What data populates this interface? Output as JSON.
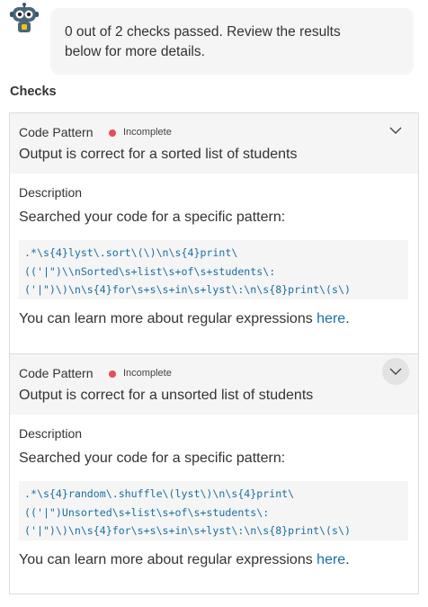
{
  "message": {
    "line1": "0 out of 2 checks passed. Review the results",
    "line2": "below for more details."
  },
  "section_title": "Checks",
  "checks": [
    {
      "type": "Code Pattern",
      "status": "Incomplete",
      "title": "Output is correct for a sorted list of students",
      "description_label": "Description",
      "description": "Searched your code for a specific pattern:",
      "pattern_lines": [
        ".*\\s{4}lyst\\.sort\\(\\)\\n\\s{4}print\\",
        "(('|\")\\\\nSorted\\s+list\\s+of\\s+students\\:",
        "('|\")\\)\\n\\s{4}for\\s+s\\s+in\\s+lyst\\:\\n\\s{8}print\\(s\\)"
      ],
      "more_prefix": "You can learn more about regular expressions ",
      "more_link": "here",
      "more_suffix": "."
    },
    {
      "type": "Code Pattern",
      "status": "Incomplete",
      "title": "Output is correct for a unsorted list of students",
      "description_label": "Description",
      "description": "Searched your code for a specific pattern:",
      "pattern_lines": [
        ".*\\s{4}random\\.shuffle\\(lyst\\)\\n\\s{4}print\\",
        "(('|\")Unsorted\\s+list\\s+of\\s+students\\:",
        "('|\")\\)\\n\\s{4}for\\s+s\\s+in\\s+lyst\\:\\n\\s{8}print\\(s\\)"
      ],
      "more_prefix": "You can learn more about regular expressions ",
      "more_link": "here",
      "more_suffix": "."
    }
  ],
  "colors": {
    "accent": "#1a6fa0",
    "status_incomplete": "#e84c55",
    "panel": "#f5f5f5"
  },
  "icons": {
    "avatar": "robot-avatar-icon",
    "expand": "chevron-down-icon"
  }
}
